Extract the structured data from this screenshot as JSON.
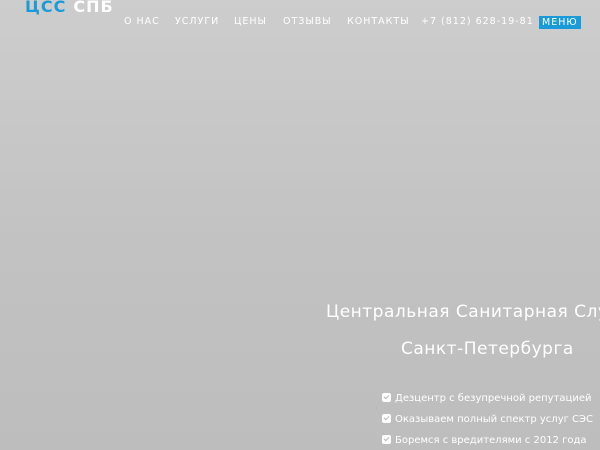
{
  "colors": {
    "accent": "#1a9ad8"
  },
  "logo": {
    "part1": "ЦСС",
    "part2": "СПБ"
  },
  "nav": {
    "items": [
      {
        "label": "О НАС"
      },
      {
        "label": "УСЛУГИ"
      },
      {
        "label": "ЦЕНЫ"
      },
      {
        "label": "ОТЗЫВЫ"
      },
      {
        "label": "КОНТАКТЫ"
      }
    ],
    "phone": "+7 (812) 628-19-81",
    "menu_label": "МЕНЮ"
  },
  "hero": {
    "title_line1": "Центральная Санитарная Слу",
    "title_line2": "Санкт-Петербурга"
  },
  "features": [
    {
      "icon": "check-square-icon",
      "text": "Дезцентр с безупречной репутацией"
    },
    {
      "icon": "check-square-icon",
      "text": "Оказываем полный спектр услуг СЭС"
    },
    {
      "icon": "check-square-icon",
      "text": "Боремся с вредителями с 2012 года"
    }
  ]
}
